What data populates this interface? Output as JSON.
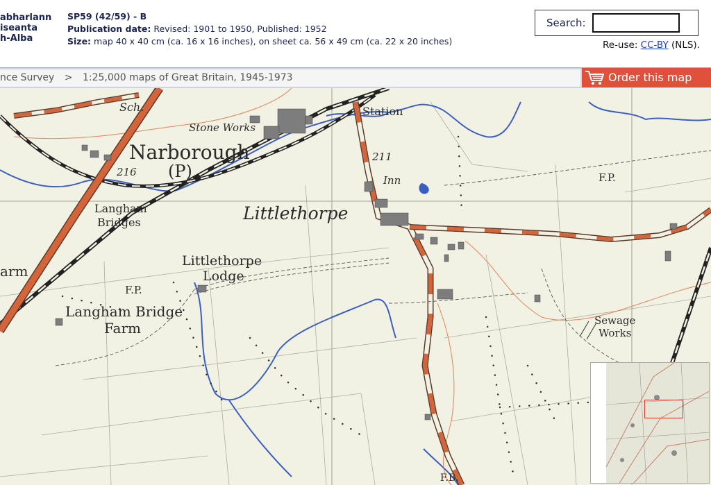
{
  "header": {
    "logo_lines": [
      "abharlann",
      "iseanta",
      "h-Alba"
    ],
    "map_title": "SP59 (42/59) - B",
    "pub_label": "Publication date:",
    "pub_value": " Revised: 1901 to 1950, Published: 1952",
    "size_label": "Size:",
    "size_value": " map 40 x 40 cm (ca. 16 x 16 inches), on sheet ca. 56 x 49 cm (ca. 22 x 20 inches)"
  },
  "search": {
    "label": "Search:",
    "value": ""
  },
  "reuse": {
    "prefix": "Re-use: ",
    "link": "CC-BY",
    "suffix": " (NLS)."
  },
  "breadcrumb": {
    "items": [
      "nce Survey",
      ">",
      "1:25,000 maps of Great Britain, 1945-1973"
    ]
  },
  "order_button": {
    "label": "Order this map"
  },
  "map_labels": {
    "sch": "Sch.",
    "station": "Station",
    "stone_works": "Stone Works",
    "narborough": "Narborough",
    "p": "(P)",
    "n216": "216",
    "n211": "211",
    "inn": "Inn",
    "fp1": "F.P.",
    "langham": "Langham",
    "bridges": "Bridges",
    "littlethorpe": "Littlethorpe",
    "arm": "arm",
    "lt_lodge_1": "Littlethorpe",
    "lt_lodge_2": "Lodge",
    "fp2": "F.P.",
    "lbf_1": "Langham Bridge",
    "lbf_2": "Farm",
    "sewage": "Sewage",
    "works": "Works",
    "fb": "F.B."
  },
  "colors": {
    "road": "#d4643a",
    "water": "#3a5fc0",
    "rail": "#222222",
    "map_bg": "#f2f2e4",
    "order": "#e0513c",
    "header_text": "#1b2350"
  },
  "icons": [
    "cart-icon"
  ]
}
